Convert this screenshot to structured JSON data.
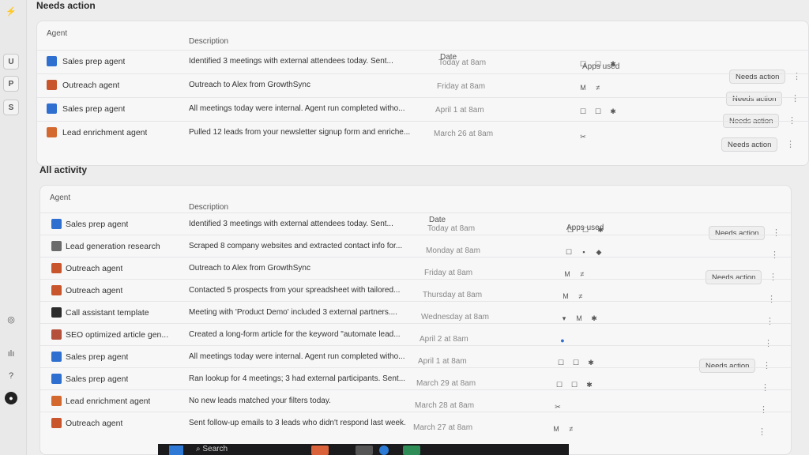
{
  "left_rail": {
    "items": [
      {
        "label": "U"
      },
      {
        "label": "P"
      },
      {
        "label": "S"
      }
    ]
  },
  "needs_action": {
    "title": "Needs action",
    "headers": {
      "agent": "Agent",
      "description": "Description",
      "date": "Date",
      "apps": "Apps used"
    },
    "rows": [
      {
        "agent": "Sales prep agent",
        "description": "Identified 3 meetings with external attendees today. Sent...",
        "date": "Today at 8am",
        "apps": [
          "☐",
          "☐",
          "✱"
        ],
        "action": "Needs action"
      },
      {
        "agent": "Outreach agent",
        "description": "Outreach to Alex from GrowthSync",
        "date": "Friday at 8am",
        "apps": [
          "M",
          "≠"
        ],
        "action": "Needs action"
      },
      {
        "agent": "Sales prep agent",
        "description": "All meetings today were internal. Agent run completed witho...",
        "date": "April 1 at 8am",
        "apps": [
          "☐",
          "☐",
          "✱"
        ],
        "action": "Needs action"
      },
      {
        "agent": "Lead enrichment agent",
        "description": "Pulled 12 leads from your newsletter signup form and enriche...",
        "date": "March 26 at 8am",
        "apps": [
          "✂"
        ],
        "action": "Needs action"
      }
    ]
  },
  "all_activity": {
    "title": "All activity",
    "headers": {
      "agent": "Agent",
      "description": "Description",
      "date": "Date",
      "apps": "Apps used"
    },
    "rows": [
      {
        "agent": "Sales prep agent",
        "description": "Identified 3 meetings with external attendees today. Sent...",
        "date": "Today at 8am",
        "apps": [
          "☐",
          "☐",
          "✱"
        ],
        "action": "Needs action"
      },
      {
        "agent": "Lead generation research",
        "description": "Scraped 8 company websites and extracted contact info for...",
        "date": "Monday at 8am",
        "apps": [
          "☐",
          "▪",
          "◆"
        ],
        "action": ""
      },
      {
        "agent": "Outreach agent",
        "description": "Outreach to Alex from GrowthSync",
        "date": "Friday at 8am",
        "apps": [
          "M",
          "≠"
        ],
        "action": "Needs action"
      },
      {
        "agent": "Outreach agent",
        "description": "Contacted 5 prospects from your spreadsheet with tailored...",
        "date": "Thursday at 8am",
        "apps": [
          "M",
          "≠"
        ],
        "action": ""
      },
      {
        "agent": "Call assistant template",
        "description": "Meeting with 'Product Demo' included 3 external partners....",
        "date": "Wednesday at 8am",
        "apps": [
          "▾",
          "M",
          "✱"
        ],
        "action": ""
      },
      {
        "agent": "SEO optimized article gen...",
        "description": "Created a long-form article for the keyword \"automate lead...",
        "date": "April 2 at 8am",
        "apps": [
          "●"
        ],
        "action": ""
      },
      {
        "agent": "Sales prep agent",
        "description": "All meetings today were internal. Agent run completed witho...",
        "date": "April 1 at 8am",
        "apps": [
          "☐",
          "☐",
          "✱"
        ],
        "action": "Needs action"
      },
      {
        "agent": "Sales prep agent",
        "description": "Ran lookup for 4 meetings; 3 had external participants. Sent...",
        "date": "March 29 at 8am",
        "apps": [
          "☐",
          "☐",
          "✱"
        ],
        "action": ""
      },
      {
        "agent": "Lead enrichment agent",
        "description": "No new leads matched your filters today.",
        "date": "March 28 at 8am",
        "apps": [
          "✂"
        ],
        "action": ""
      },
      {
        "agent": "Outreach agent",
        "description": "Sent follow-up emails to 3 leads who didn't respond last week.",
        "date": "March 27 at 8am",
        "apps": [
          "M",
          "≠"
        ],
        "action": ""
      }
    ]
  },
  "taskbar": {
    "search_label": "Search"
  },
  "colors": {
    "sales": "#2f6fd0",
    "outreach": "#c8552b",
    "lead": "#d4692f",
    "research": "#6b6b6b",
    "call": "#2b2b2b",
    "seo": "#b5503a"
  }
}
